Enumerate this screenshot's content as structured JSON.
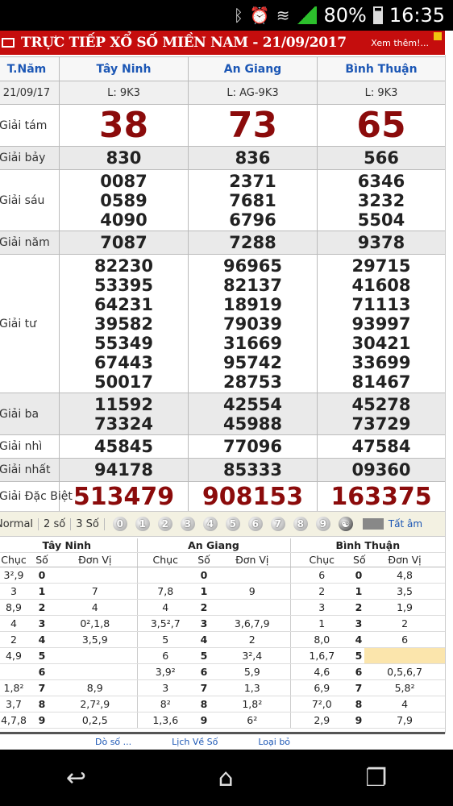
{
  "status": {
    "battery": "80%",
    "time": "16:35"
  },
  "header": {
    "title": "TRỰC TIẾP XỔ SỐ MIỀN NAM - 21/09/2017",
    "more": "Xem thêm!..."
  },
  "results": {
    "corner": "T.Năm",
    "date": "21/09/17",
    "provinces": [
      "Tây Ninh",
      "An Giang",
      "Bình Thuận"
    ],
    "lots": [
      "L: 9K3",
      "L: AG-9K3",
      "L: 9K3"
    ],
    "labels": {
      "g8": "Giải tám",
      "g7": "Giải bảy",
      "g6": "Giải sáu",
      "g5": "Giải năm",
      "g4": "Giải tư",
      "g3": "Giải ba",
      "g2": "Giải nhì",
      "g1": "Giải nhất",
      "db": "Giải Đặc Biệt"
    },
    "g8": [
      "38",
      "73",
      "65"
    ],
    "g7": [
      "830",
      "836",
      "566"
    ],
    "g6": [
      [
        "0087",
        "0589",
        "4090"
      ],
      [
        "2371",
        "7681",
        "6796"
      ],
      [
        "6346",
        "3232",
        "5504"
      ]
    ],
    "g5": [
      "7087",
      "7288",
      "9378"
    ],
    "g4": [
      [
        "82230",
        "53395",
        "64231",
        "39582",
        "55349",
        "67443",
        "50017"
      ],
      [
        "96965",
        "82137",
        "18919",
        "79039",
        "31669",
        "95742",
        "28753"
      ],
      [
        "29715",
        "41608",
        "71113",
        "93997",
        "30421",
        "33699",
        "81467"
      ]
    ],
    "g3": [
      [
        "11592",
        "73324"
      ],
      [
        "42554",
        "45988"
      ],
      [
        "45278",
        "73729"
      ]
    ],
    "g2": [
      "45845",
      "77096",
      "47584"
    ],
    "g1": [
      "94178",
      "85333",
      "09360"
    ],
    "db": [
      "513479",
      "908153",
      "163375"
    ]
  },
  "tools": {
    "options": [
      "Normal",
      "2 số",
      "3 Số"
    ],
    "balls": [
      "0",
      "1",
      "2",
      "3",
      "4",
      "5",
      "6",
      "7",
      "8",
      "9"
    ],
    "tat_am": "Tất âm"
  },
  "loto": {
    "provinces": [
      "Tây Ninh",
      "An Giang",
      "Bình Thuận"
    ],
    "col_headers": [
      "Chục",
      "Số",
      "Đơn Vị"
    ],
    "rows": [
      [
        "3²,9",
        "0",
        "",
        "",
        "0",
        "",
        "6",
        "0",
        "4,8"
      ],
      [
        "3",
        "1",
        "7",
        "7,8",
        "1",
        "9",
        "2",
        "1",
        "3,5"
      ],
      [
        "8,9",
        "2",
        "4",
        "4",
        "2",
        "",
        "3",
        "2",
        "1,9"
      ],
      [
        "4",
        "3",
        "0²,1,8",
        "3,5²,7",
        "3",
        "3,6,7,9",
        "1",
        "3",
        "2"
      ],
      [
        "2",
        "4",
        "3,5,9",
        "5",
        "4",
        "2",
        "8,0",
        "4",
        "6"
      ],
      [
        "4,9",
        "5",
        "",
        "6",
        "5",
        "3²,4",
        "1,6,7",
        "5",
        ""
      ],
      [
        "",
        "6",
        "",
        "3,9²",
        "6",
        "5,9",
        "4,6",
        "6",
        "0,5,6,7"
      ],
      [
        "1,8²",
        "7",
        "8,9",
        "3",
        "7",
        "1,3",
        "6,9",
        "7",
        "5,8²"
      ],
      [
        "3,7",
        "8",
        "2,7²,9",
        "8²",
        "8",
        "1,8²",
        "7²,0",
        "8",
        "4"
      ],
      [
        "4,7,8",
        "9",
        "0,2,5",
        "1,3,6",
        "9",
        "6²",
        "2,9",
        "9",
        "7,9"
      ]
    ]
  },
  "footer": {
    "links": [
      "Dò số ...",
      "Lịch Về Số",
      "Loại bỏ"
    ]
  }
}
